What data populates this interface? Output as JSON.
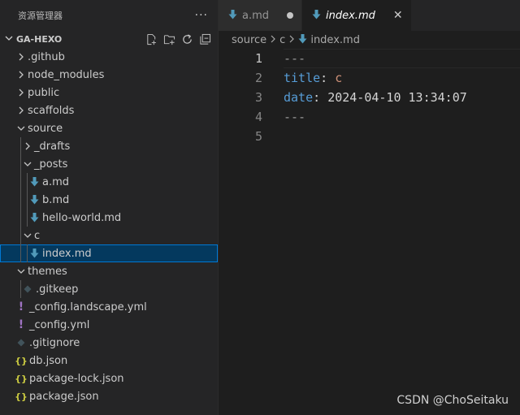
{
  "sidebar": {
    "title": "资源管理器",
    "more": "···",
    "section": "GA-HEXO",
    "items": [
      {
        "label": ".github",
        "kind": "folder",
        "open": false,
        "depth": 0
      },
      {
        "label": "node_modules",
        "kind": "folder",
        "open": false,
        "depth": 0
      },
      {
        "label": "public",
        "kind": "folder",
        "open": false,
        "depth": 0
      },
      {
        "label": "scaffolds",
        "kind": "folder",
        "open": false,
        "depth": 0
      },
      {
        "label": "source",
        "kind": "folder",
        "open": true,
        "depth": 0
      },
      {
        "label": "_drafts",
        "kind": "folder",
        "open": false,
        "depth": 1
      },
      {
        "label": "_posts",
        "kind": "folder",
        "open": true,
        "depth": 1
      },
      {
        "label": "a.md",
        "kind": "md",
        "depth": 2
      },
      {
        "label": "b.md",
        "kind": "md",
        "depth": 2
      },
      {
        "label": "hello-world.md",
        "kind": "md",
        "depth": 2
      },
      {
        "label": "c",
        "kind": "folder",
        "open": true,
        "depth": 1
      },
      {
        "label": "index.md",
        "kind": "md",
        "depth": 2,
        "selected": true
      },
      {
        "label": "themes",
        "kind": "folder",
        "open": true,
        "depth": 0
      },
      {
        "label": ".gitkeep",
        "kind": "git",
        "depth": 1
      },
      {
        "label": "_config.landscape.yml",
        "kind": "yml",
        "depth": 0
      },
      {
        "label": "_config.yml",
        "kind": "yml",
        "depth": 0
      },
      {
        "label": ".gitignore",
        "kind": "git",
        "depth": 0
      },
      {
        "label": "db.json",
        "kind": "json",
        "depth": 0
      },
      {
        "label": "package-lock.json",
        "kind": "json",
        "depth": 0
      },
      {
        "label": "package.json",
        "kind": "json",
        "depth": 0
      }
    ]
  },
  "tabs": [
    {
      "label": "a.md",
      "active": false,
      "modified": true
    },
    {
      "label": "index.md",
      "active": true,
      "close": "✕"
    }
  ],
  "breadcrumbs": [
    "source",
    "c",
    "index.md"
  ],
  "editor": {
    "lines": [
      {
        "num": "1",
        "tokens": [
          {
            "t": "---",
            "c": "tok-delim"
          }
        ]
      },
      {
        "num": "2",
        "tokens": [
          {
            "t": "title",
            "c": "tok-key"
          },
          {
            "t": ": ",
            "c": "tok-punct"
          },
          {
            "t": "c",
            "c": "tok-val"
          }
        ]
      },
      {
        "num": "3",
        "tokens": [
          {
            "t": "date",
            "c": "tok-key"
          },
          {
            "t": ": ",
            "c": "tok-punct"
          },
          {
            "t": "2024-04-10 13:34:07",
            "c": "tok-date"
          }
        ]
      },
      {
        "num": "4",
        "tokens": [
          {
            "t": "---",
            "c": "tok-delim"
          }
        ]
      },
      {
        "num": "5",
        "tokens": []
      }
    ],
    "current_line": 1
  },
  "watermark": "CSDN @ChoSeitaku",
  "colors": {
    "selection": "#04395e",
    "focus_border": "#0078d4",
    "md_icon": "#519aba",
    "yml_icon": "#a074c4",
    "json_icon": "#cbcb41"
  }
}
